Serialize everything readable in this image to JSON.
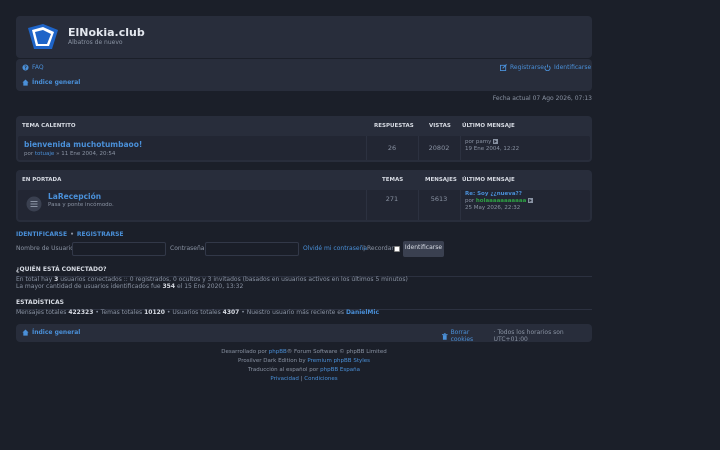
{
  "site": {
    "title": "ElNokia.club",
    "description": "Albatros de nuevo"
  },
  "nav": {
    "faq": "FAQ",
    "register": "Registrarse",
    "login": "Identificarse",
    "breadcrumb": "Índice general"
  },
  "date_line": "Fecha actual 07 Ago 2026, 07:13",
  "topic_table": {
    "header": "TEMA CALENTITO",
    "col_replies": "RESPUESTAS",
    "col_views": "VISTAS",
    "col_last": "ÚLTIMO MENSAJE",
    "rows": [
      {
        "title": "bienvenida muchotumbaoo!",
        "by": "por",
        "author": "totuaje",
        "date": "» 11 Ene 2004, 20:54",
        "replies": "26",
        "views": "20802",
        "last_by": "por",
        "last_author": "pamy",
        "last_date": "19 Ene 2004, 12:22"
      }
    ]
  },
  "forum_table": {
    "header": "EN PORTADA",
    "col_topics": "TEMAS",
    "col_posts": "MENSAJES",
    "col_last": "ÚLTIMO MENSAJE",
    "rows": [
      {
        "title": "LaRecepción",
        "description": "Pasa y ponte incómodo.",
        "topics": "271",
        "posts": "5613",
        "last_title": "Re: Soy ¿¿nueva??",
        "last_by": "por",
        "last_author": "holaaaaaaaaaaa",
        "last_date": "25 May 2026, 22:32"
      }
    ]
  },
  "login": {
    "link_login": "IDENTIFICARSE",
    "bullet": "•",
    "link_register": "REGISTRARSE",
    "username_label": "Nombre de Usuario:",
    "password_label": "Contraseña:",
    "forgot": "Olvidé mi contraseña",
    "pipe": "|",
    "remember": "Recordar",
    "submit": "Identificarse"
  },
  "online": {
    "title": "¿QUIÉN ESTÁ CONECTADO?",
    "line1_pre": "En total hay",
    "line1_count": "3",
    "line1_post": "usuarios conectados :: 0 registrados, 0 ocultos y 3 invitados (basados en usuarios activos en los últimos 5 minutos)",
    "line2_pre": "La mayor cantidad de usuarios identificados fue",
    "line2_count": "354",
    "line2_post": "el 15 Ene 2020, 13:32"
  },
  "stats": {
    "title": "ESTADÍSTICAS",
    "posts_label": "Mensajes totales",
    "posts": "422323",
    "topics_label": "• Temas totales",
    "topics": "10120",
    "users_label": "• Usuarios totales",
    "users": "4307",
    "newest_label": "• Nuestro usuario más reciente es",
    "newest": "DanielMic"
  },
  "footer_nav": {
    "breadcrumb": "Índice general",
    "cookies": "Borrar cookies",
    "timezone": "· Todos los horarios son UTC+01:00"
  },
  "credits": {
    "line1_pre": "Desarrollado por",
    "line1_link": "phpBB",
    "line1_post": "® Forum Software © phpBB Limited",
    "line2_pre": "Prosilver Dark Edition by",
    "line2_link": "Premium phpBB Styles",
    "line3_pre": "Traducción al español por",
    "line3_link": "phpBB España",
    "privacy": "Privacidad",
    "sep": "|",
    "terms": "Condiciones"
  },
  "colors": {
    "accent": "#4a90d9",
    "panel": "#282d3b",
    "background": "#1b1f29",
    "newest_user": "#4a90d9",
    "last_author": "#2ea043"
  }
}
